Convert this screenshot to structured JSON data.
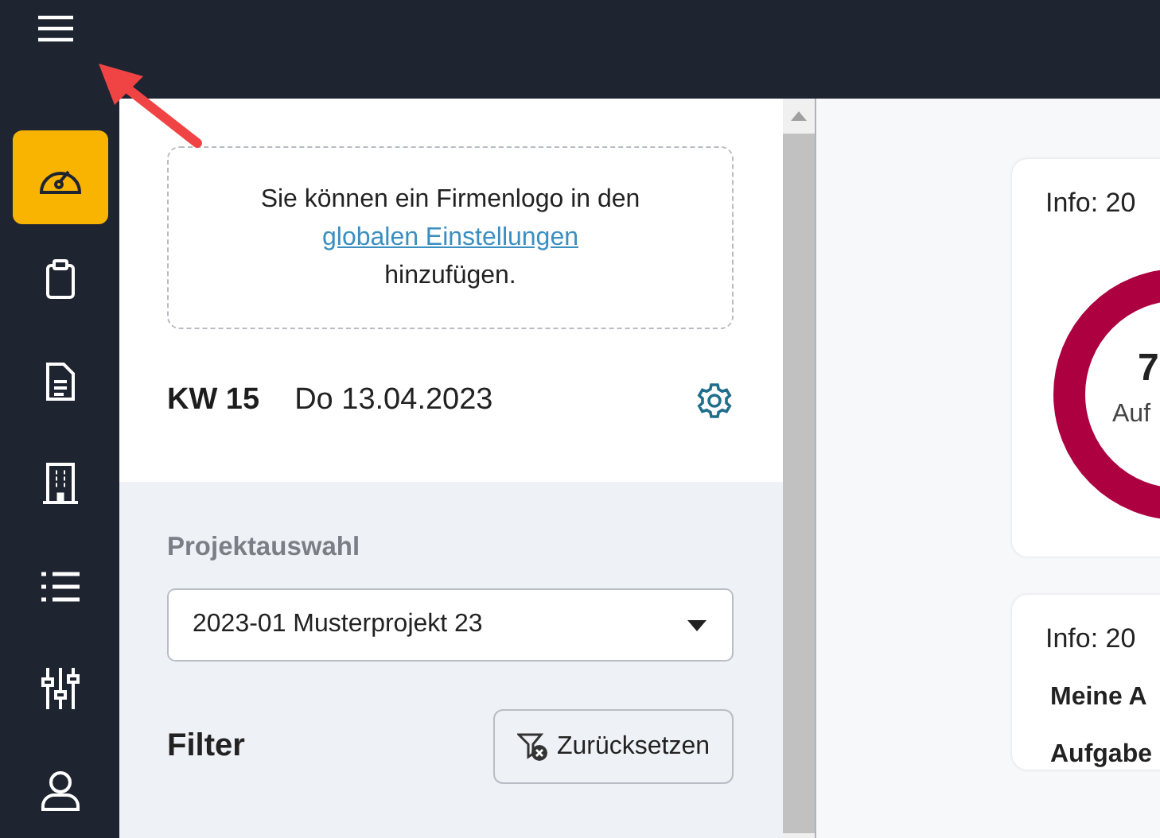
{
  "nav_items": [
    {
      "selected": true
    },
    {
      "selected": false
    },
    {
      "selected": false
    },
    {
      "selected": false
    },
    {
      "selected": false
    },
    {
      "selected": false
    },
    {
      "selected": false
    }
  ],
  "logo_notice": {
    "before": "Sie können ein Firmenlogo in den",
    "link": "globalen Einstellungen",
    "after": "hinzufügen."
  },
  "week": "KW 15",
  "date": "Do 13.04.2023",
  "project_select": {
    "label": "Projektauswahl",
    "value": "2023-01 Musterprojekt 23"
  },
  "filter": {
    "title": "Filter",
    "reset_button": "Zurücksetzen"
  },
  "cards": [
    {
      "kind": "donut",
      "title": "Info: 20",
      "count": "7",
      "caption": "Auf"
    },
    {
      "kind": "list",
      "title": "Info: 20",
      "rows": [
        "Meine A",
        "Aufgabe"
      ]
    }
  ]
}
